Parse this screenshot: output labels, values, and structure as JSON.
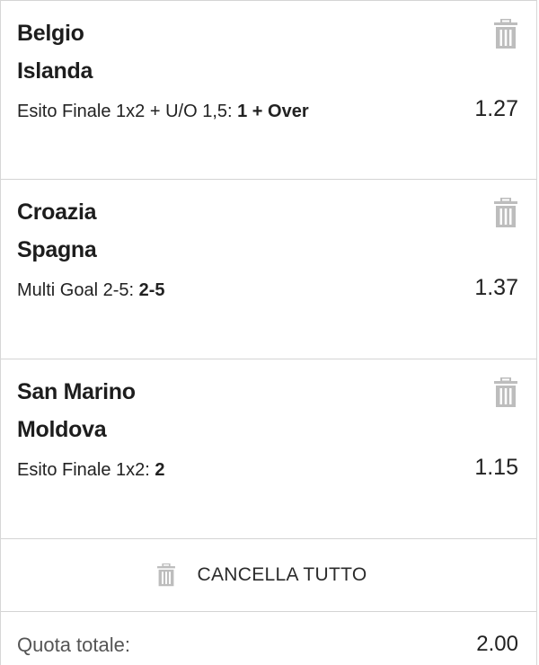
{
  "bets": [
    {
      "home": "Belgio",
      "away": "Islanda",
      "market": "Esito Finale 1x2 + U/O 1,5: ",
      "pick": "1 + Over",
      "odd": "1.27",
      "remove_icon": "trash-icon"
    },
    {
      "home": "Croazia",
      "away": "Spagna",
      "market": "Multi Goal 2-5: ",
      "pick": "2-5",
      "odd": "1.37",
      "remove_icon": "trash-icon"
    },
    {
      "home": "San Marino",
      "away": "Moldova",
      "market": "Esito Finale 1x2: ",
      "pick": "2",
      "odd": "1.15",
      "remove_icon": "trash-icon"
    }
  ],
  "clear_all": {
    "label": "CANCELLA TUTTO",
    "icon": "trash-icon"
  },
  "total": {
    "label": "Quota totale:",
    "value": "2.00"
  },
  "colors": {
    "text": "#1a1a1a",
    "icon": "#bdbdbd",
    "divider": "#d4d4d4",
    "muted": "#555555"
  }
}
